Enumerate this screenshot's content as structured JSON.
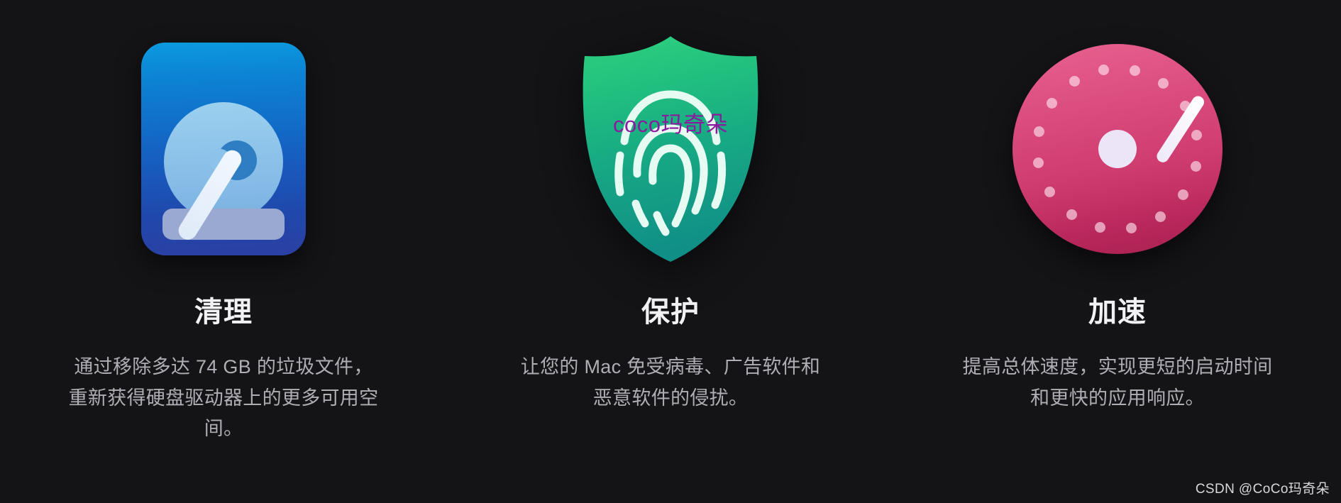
{
  "page": {
    "background_color": "#141417",
    "watermark_overlay": "coco玛奇朵",
    "watermark_overlay_color": "#8b1a9e",
    "footer_watermark": "CSDN @CoCo玛奇朵"
  },
  "features": [
    {
      "icon_name": "hard-drive-icon",
      "accent_color": "#1464c4",
      "title": "清理",
      "description": "通过移除多达 74 GB 的垃圾文件，重新获得硬盘驱动器上的更多可用空间。"
    },
    {
      "icon_name": "shield-fingerprint-icon",
      "accent_color": "#19b574",
      "title": "保护",
      "description": "让您的 Mac 免受病毒、广告软件和恶意软件的侵扰。"
    },
    {
      "icon_name": "speedometer-icon",
      "accent_color": "#d23c70",
      "title": "加速",
      "description": "提高总体速度，实现更短的启动时间和更快的应用响应。"
    }
  ]
}
